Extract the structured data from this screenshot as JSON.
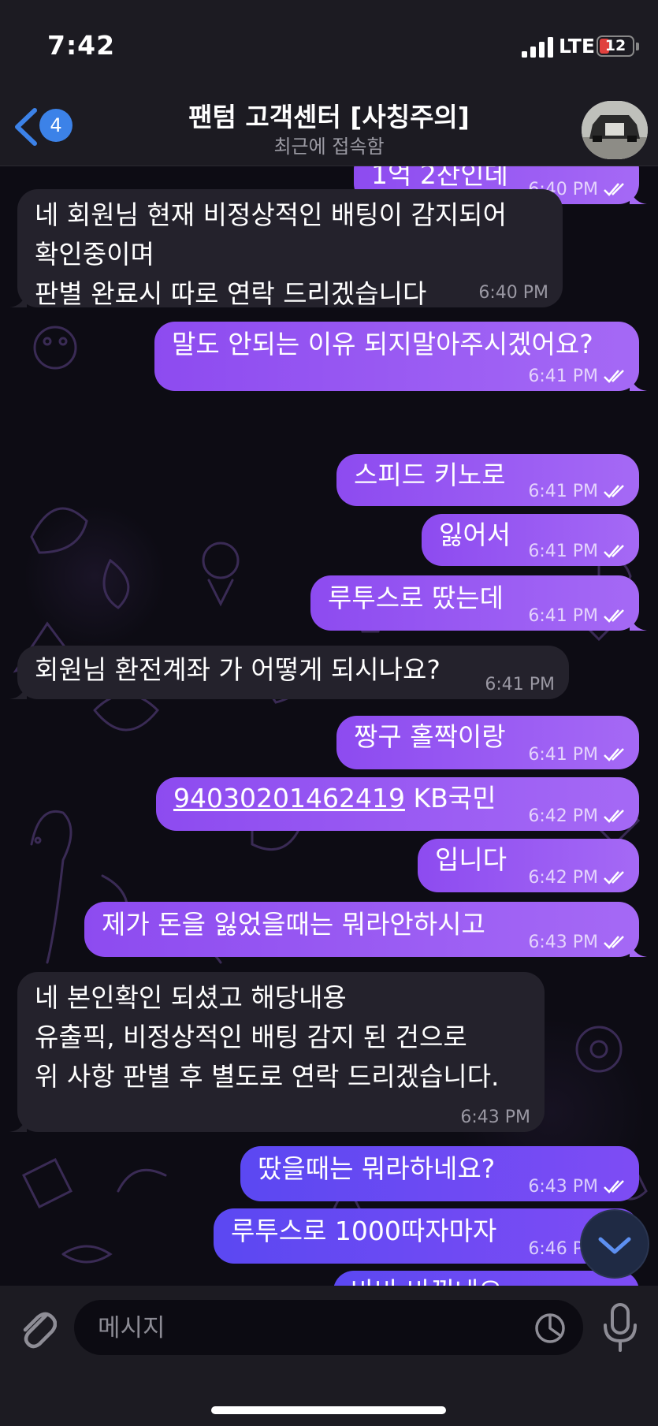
{
  "status": {
    "time": "7:42",
    "network": "LTE",
    "battery": "12"
  },
  "header": {
    "back_count": "4",
    "title": "팬텀 고객센터 [사칭주의]",
    "subtitle": "최근에 접속함"
  },
  "messages": [
    {
      "dir": "out",
      "text": "1억 2잔인데",
      "time": "6:40 PM"
    },
    {
      "dir": "in",
      "lines": [
        "네 회원님 현재 비정상적인 배팅이 감지되어",
        "확인중이며",
        "판별 완료시 따로 연락 드리겠습니다"
      ],
      "time": "6:40 PM"
    },
    {
      "dir": "out",
      "text": "말도 안되는 이유 되지말아주시겠어요?",
      "time": "6:41 PM"
    },
    {
      "dir": "out",
      "text": "스피드 키노로",
      "time": "6:41 PM"
    },
    {
      "dir": "out",
      "text": "잃어서",
      "time": "6:41 PM"
    },
    {
      "dir": "out",
      "text": "루투스로 땄는데",
      "time": "6:41 PM"
    },
    {
      "dir": "in",
      "text": "회원님 환전계좌 가 어떻게 되시나요?",
      "time": "6:41 PM"
    },
    {
      "dir": "out",
      "text": "짱구 홀짝이랑",
      "time": "6:41 PM"
    },
    {
      "dir": "out",
      "link": "94030201462419",
      "text": " KB국민",
      "time": "6:42 PM"
    },
    {
      "dir": "out",
      "text": "입니다",
      "time": "6:42 PM"
    },
    {
      "dir": "out",
      "text": "제가 돈을 잃었을때는 뭐라안하시고",
      "time": "6:43 PM"
    },
    {
      "dir": "in",
      "lines": [
        "네 본인확인 되셨고 해당내용",
        "유출픽, 비정상적인 배팅 감지 된 건으로",
        "위 사항 판별 후 별도로 연락 드리겠습니다."
      ],
      "time": "6:43 PM"
    },
    {
      "dir": "out",
      "text": "땄을때는 뭐라하네요?",
      "time": "6:43 PM"
    },
    {
      "dir": "out",
      "text": "루투스로 1000따자마자",
      "time": "6:46 PM"
    },
    {
      "dir": "out",
      "text": "바바 바꿨네요",
      "time": ""
    }
  ],
  "composer": {
    "placeholder": "메시지"
  },
  "icons": {
    "back": "chevron-left-icon",
    "attach": "paperclip-icon",
    "sticker": "sticker-icon",
    "mic": "microphone-icon",
    "scroll_down": "chevron-down-icon",
    "read_status": "double-check-icon"
  },
  "colors": {
    "outgoing_bubble": "#9a5cf3",
    "incoming_bubble": "#24222c",
    "accent": "#3c82e8",
    "background": "#0d0c14"
  }
}
